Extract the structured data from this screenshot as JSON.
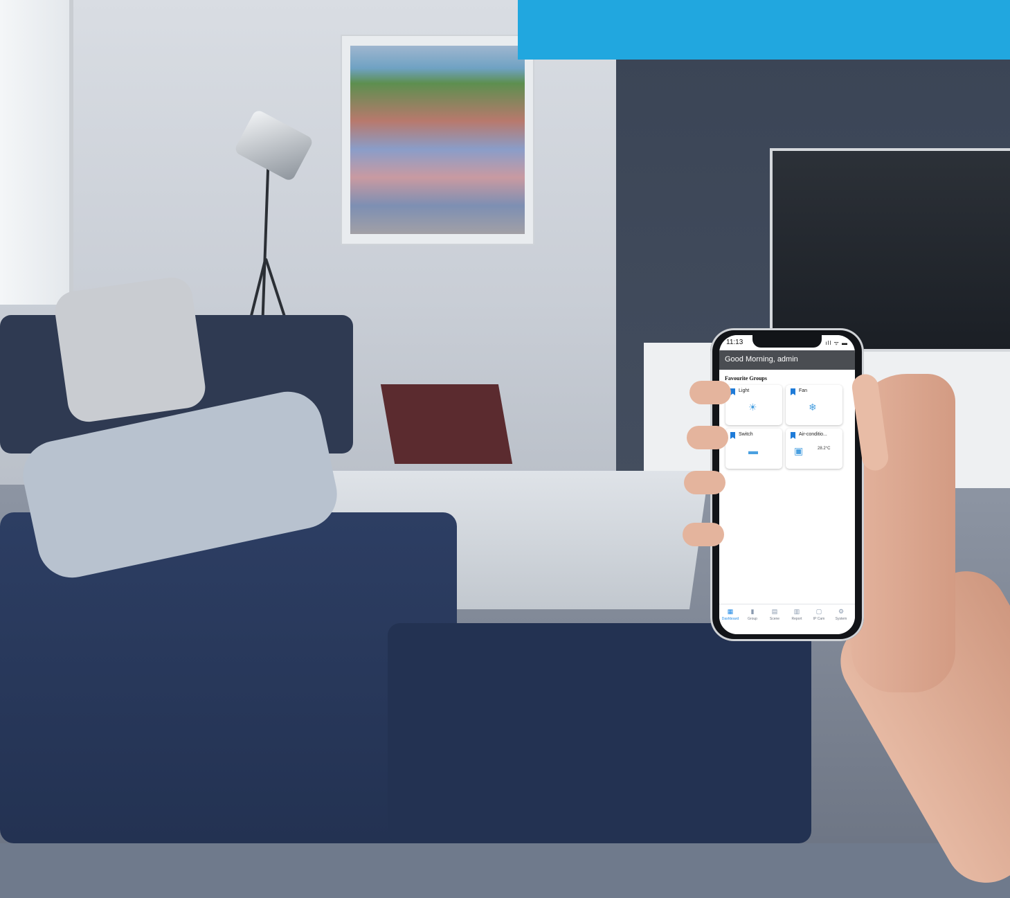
{
  "phone": {
    "status_time": "11:13",
    "status_icons": "ıll ᯤ ▬",
    "greeting": "Good Morning, admin",
    "section_title": "Favourite Groups",
    "cards": [
      {
        "label": "Light",
        "icon": "light-bulb-icon",
        "glyph": "☀"
      },
      {
        "label": "Fan",
        "icon": "fan-icon",
        "glyph": "❄"
      },
      {
        "label": "Switch",
        "icon": "switch-icon",
        "glyph": "▬"
      },
      {
        "label": "Air-conditio...",
        "icon": "air-conditioner-icon",
        "glyph": "▣",
        "temp": "28.2°C"
      }
    ],
    "tabs": [
      {
        "label": "Dashboard",
        "icon": "dashboard-icon",
        "glyph": "▦",
        "active": true
      },
      {
        "label": "Group",
        "icon": "group-icon",
        "glyph": "▮"
      },
      {
        "label": "Scene",
        "icon": "scene-icon",
        "glyph": "▤"
      },
      {
        "label": "Report",
        "icon": "report-icon",
        "glyph": "▥"
      },
      {
        "label": "IP Cam",
        "icon": "ip-cam-icon",
        "glyph": "▢"
      },
      {
        "label": "System",
        "icon": "system-gear-icon",
        "glyph": "⚙"
      }
    ],
    "accent_color": "#1e88e5"
  },
  "banner": {
    "color": "#21a7df"
  }
}
